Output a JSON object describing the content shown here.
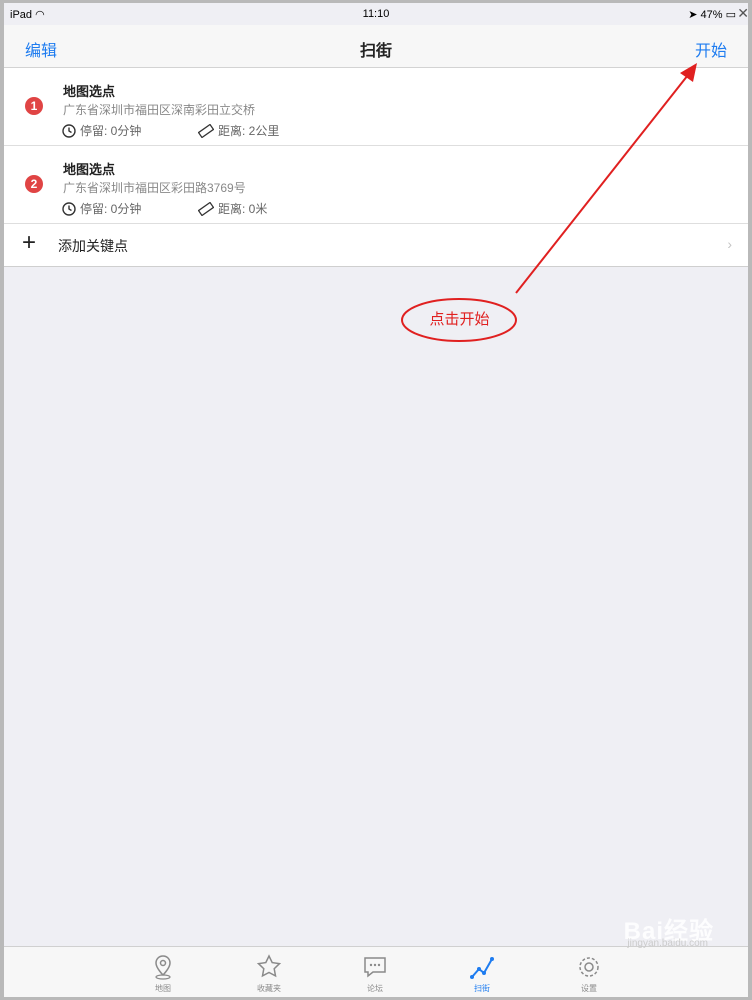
{
  "status_bar": {
    "device": "iPad",
    "time": "11:10",
    "battery": "47%"
  },
  "nav": {
    "left": "编辑",
    "title": "扫街",
    "right": "开始"
  },
  "items": [
    {
      "index": "1",
      "title": "地图选点",
      "address": "广东省深圳市福田区深南彩田立交桥",
      "stay": "停留: 0分钟",
      "distance": "距离: 2公里"
    },
    {
      "index": "2",
      "title": "地图选点",
      "address": "广东省深圳市福田区彩田路3769号",
      "stay": "停留: 0分钟",
      "distance": "距离: 0米"
    }
  ],
  "add_row": {
    "label": "添加关键点"
  },
  "annotation": {
    "text": "点击开始",
    "color": "#e02020"
  },
  "tabs": [
    {
      "label": "地图",
      "icon": "map-pin-icon",
      "active": false
    },
    {
      "label": "收藏夹",
      "icon": "star-icon",
      "active": false
    },
    {
      "label": "论坛",
      "icon": "chat-icon",
      "active": false
    },
    {
      "label": "扫街",
      "icon": "route-icon",
      "active": true
    },
    {
      "label": "设置",
      "icon": "gear-icon",
      "active": false
    }
  ],
  "watermark": {
    "brand": "Bai经验",
    "url": "jingyan.baidu.com"
  },
  "colors": {
    "accent": "#1e7cf0",
    "badge": "#e04444",
    "annotation": "#e02020"
  }
}
